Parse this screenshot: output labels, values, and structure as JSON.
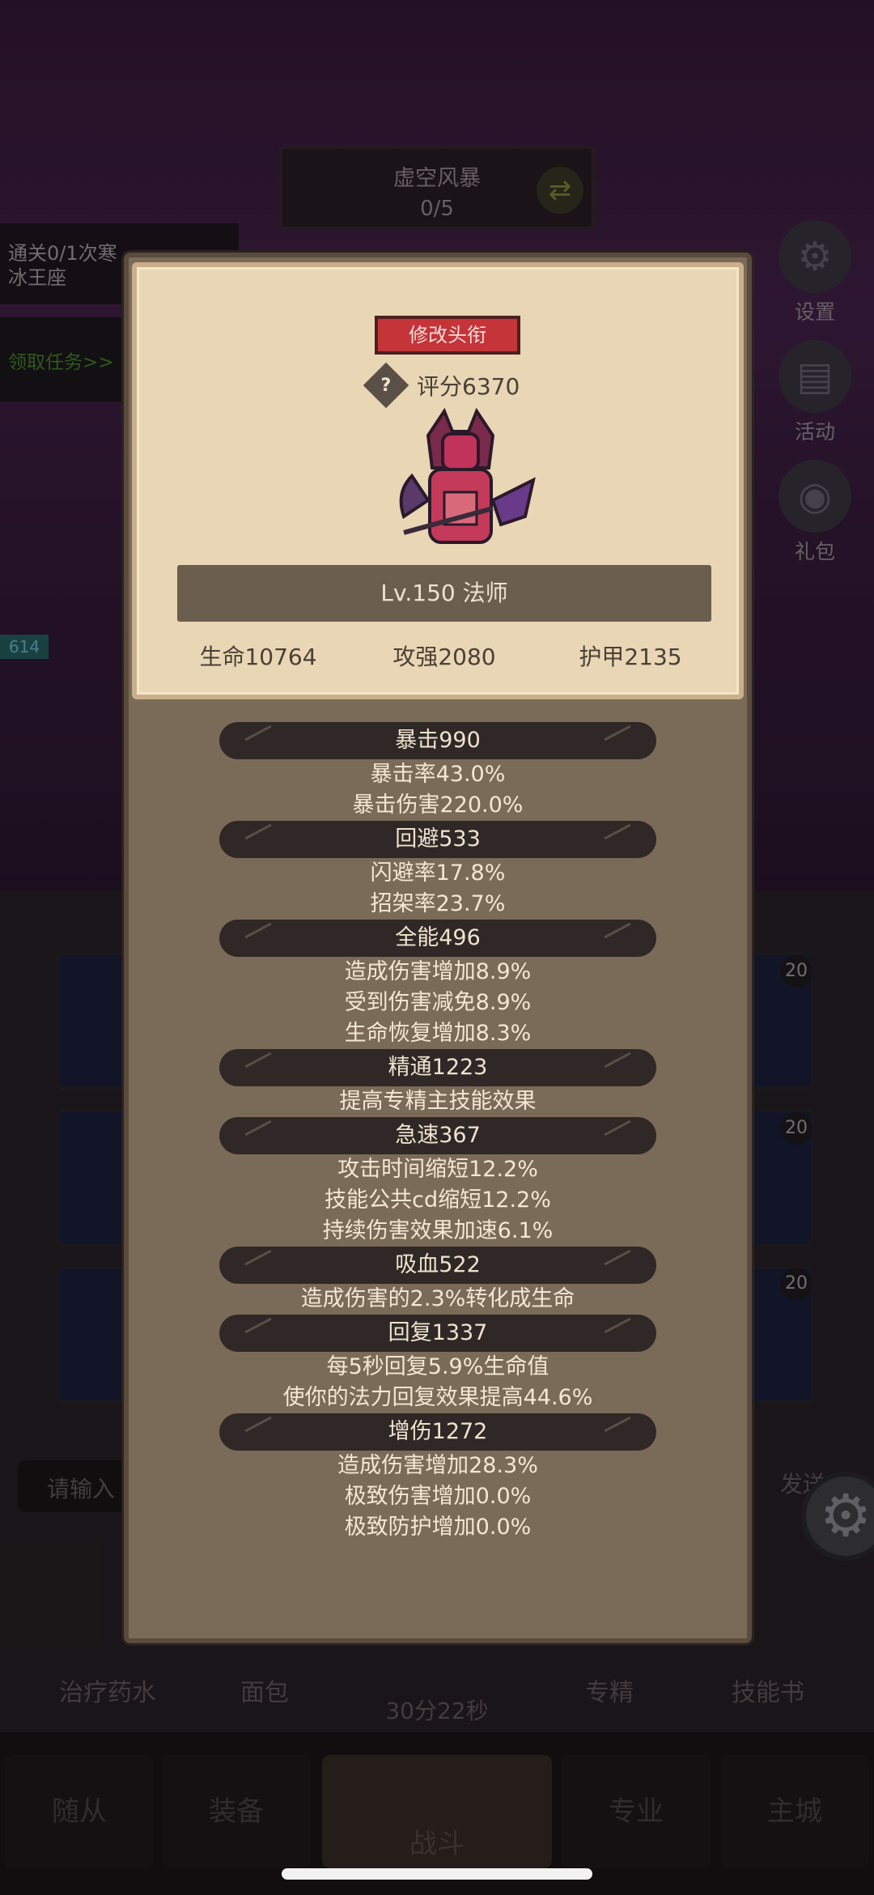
{
  "stage": {
    "name": "虚空风暴",
    "progress": "0/5"
  },
  "quest": {
    "line1": "通关0/1次寒",
    "line2": "冰王座",
    "link": "领取任务>>"
  },
  "side_icons": [
    {
      "label": "设置",
      "icon": "gear-icon"
    },
    {
      "label": "活动",
      "icon": "scroll-icon"
    },
    {
      "label": "礼包",
      "icon": "gift-icon"
    }
  ],
  "side_badge": "614",
  "slot_badges": [
    "20",
    "20",
    "20"
  ],
  "chat": {
    "placeholder": "请输入",
    "send": "发送"
  },
  "actions": [
    "治疗药水",
    "面包",
    "专精",
    "技能书"
  ],
  "timer": "30分22秒",
  "nav": [
    "随从",
    "装备",
    "战斗",
    "专业",
    "主城"
  ],
  "profile": {
    "edit_title_button": "修改头衔",
    "score": "评分6370",
    "level_class": "Lv.150 法师",
    "hp": "生命10764",
    "attack": "攻强2080",
    "armor": "护甲2135"
  },
  "attributes": [
    {
      "header": "暴击990",
      "lines": [
        "暴击率43.0%",
        "暴击伤害220.0%"
      ]
    },
    {
      "header": "回避533",
      "lines": [
        "闪避率17.8%",
        "招架率23.7%"
      ]
    },
    {
      "header": "全能496",
      "lines": [
        "造成伤害增加8.9%",
        "受到伤害减免8.9%",
        "生命恢复增加8.3%"
      ]
    },
    {
      "header": "精通1223",
      "lines": [
        "提高专精主技能效果"
      ]
    },
    {
      "header": "急速367",
      "lines": [
        "攻击时间缩短12.2%",
        "技能公共cd缩短12.2%",
        "持续伤害效果加速6.1%"
      ]
    },
    {
      "header": "吸血522",
      "lines": [
        "造成伤害的2.3%转化成生命"
      ]
    },
    {
      "header": "回复1337",
      "lines": [
        "每5秒回复5.9%生命值",
        "使你的法力回复效果提高44.6%"
      ]
    },
    {
      "header": "增伤1272",
      "lines": [
        "造成伤害增加28.3%",
        "极致伤害增加0.0%",
        "极致防护增加0.0%"
      ]
    }
  ]
}
